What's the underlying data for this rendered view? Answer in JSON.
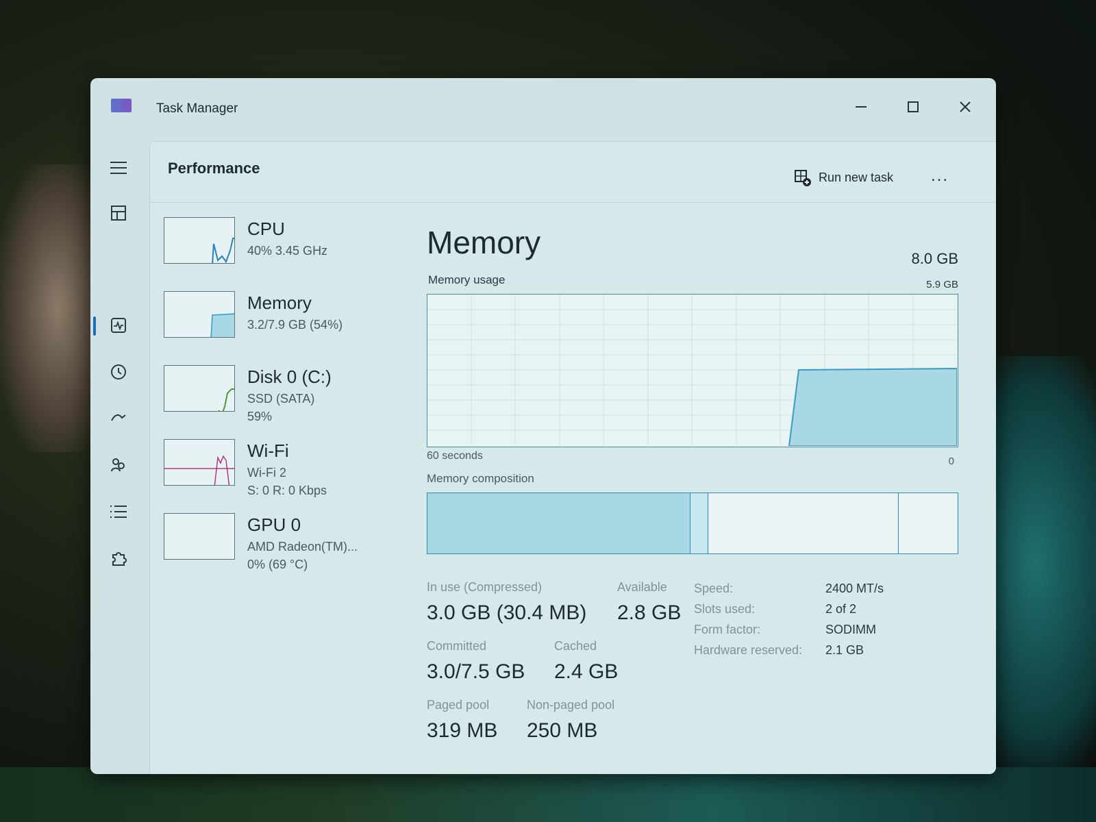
{
  "window": {
    "title": "Task Manager"
  },
  "header": {
    "page_title": "Performance",
    "run_new_task": "Run new task",
    "more": "..."
  },
  "perf_items": [
    {
      "title": "CPU",
      "sub1": "40% 3.45 GHz",
      "sub2": "",
      "sub3": ""
    },
    {
      "title": "Memory",
      "sub1": "3.2/7.9 GB (54%)",
      "sub2": "",
      "sub3": ""
    },
    {
      "title": "Disk 0 (C:)",
      "sub1": "SSD (SATA)",
      "sub2": "59%",
      "sub3": ""
    },
    {
      "title": "Wi-Fi",
      "sub1": "Wi-Fi 2",
      "sub2": "S: 0 R: 0 Kbps",
      "sub3": ""
    },
    {
      "title": "GPU 0",
      "sub1": "AMD Radeon(TM)...",
      "sub2": "0% (69 °C)",
      "sub3": ""
    }
  ],
  "detail": {
    "title": "Memory",
    "total": "8.0 GB",
    "usage_label": "Memory usage",
    "usage_max": "5.9 GB",
    "time_label": "60 seconds",
    "zero_label": "0",
    "composition_label": "Memory composition"
  },
  "stats": {
    "in_use_label": "In use (Compressed)",
    "in_use_value": "3.0 GB (30.4 MB)",
    "available_label": "Available",
    "available_value": "2.8 GB",
    "committed_label": "Committed",
    "committed_value": "3.0/7.5 GB",
    "cached_label": "Cached",
    "cached_value": "2.4 GB",
    "paged_label": "Paged pool",
    "paged_value": "319 MB",
    "nonpaged_label": "Non-paged pool",
    "nonpaged_value": "250 MB"
  },
  "specs": {
    "speed_label": "Speed:",
    "speed_value": "2400 MT/s",
    "slots_label": "Slots used:",
    "slots_value": "2 of 2",
    "form_label": "Form factor:",
    "form_value": "SODIMM",
    "hw_label": "Hardware reserved:",
    "hw_value": "2.1 GB"
  },
  "colors": {
    "accent": "#1d6fb8",
    "memory_fill": "#a8d7e6",
    "memory_line": "#3a9ac4"
  }
}
